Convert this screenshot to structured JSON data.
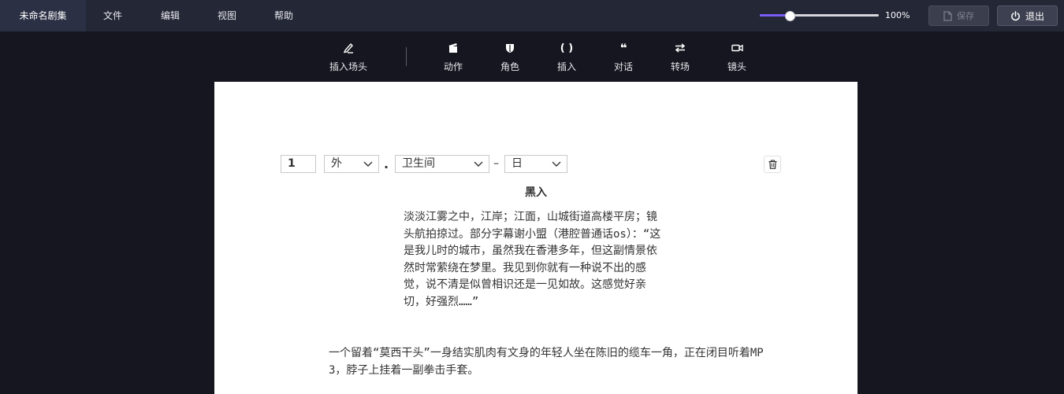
{
  "menubar": {
    "title": "未命名剧集",
    "items": [
      "文件",
      "编辑",
      "视图",
      "帮助"
    ],
    "zoom": {
      "value": 0.25,
      "label": "100%"
    },
    "save_label": "保存",
    "exit_label": "退出"
  },
  "toolbar": {
    "items": [
      {
        "label": "插入场头",
        "icon": "scene-header-icon"
      },
      {
        "label": "动作",
        "icon": "clapperboard-icon"
      },
      {
        "label": "角色",
        "icon": "mask-icon"
      },
      {
        "label": "插入",
        "icon": "parentheses-icon"
      },
      {
        "label": "对话",
        "icon": "quote-icon"
      },
      {
        "label": "转场",
        "icon": "swap-arrows-icon"
      },
      {
        "label": "镜头",
        "icon": "camera-icon"
      }
    ],
    "paren_glyph": "( )",
    "quote_glyph": "❝"
  },
  "scene": {
    "number": "1",
    "int_ext": "外",
    "location": "卫生间",
    "separator_dot": ".",
    "separator_dash": "–",
    "time": "日"
  },
  "script": {
    "transition": "黑入",
    "dialogue": "淡淡江雾之中，江岸；江面，山城街道高楼平房；镜头航拍掠过。部分字幕谢小盟（港腔普通话os）：“这是我儿时的城市，虽然我在香港多年，但这副情景依然时常萦绕在梦里。我见到你就有一种说不出的感觉，说不清是似曾相识还是一见如故。这感觉好亲切，好强烈……”",
    "action": "一个留着“莫西干头”一身结实肌肉有文身的年轻人坐在陈旧的缆车一角，正在闭目听着MP3，脖子上挂着一副拳击手套。"
  },
  "colors": {
    "accent": "#7c5cf7",
    "menubar_bg": "#232736",
    "app_bg": "#15161f",
    "paper_bg": "#ffffff"
  }
}
